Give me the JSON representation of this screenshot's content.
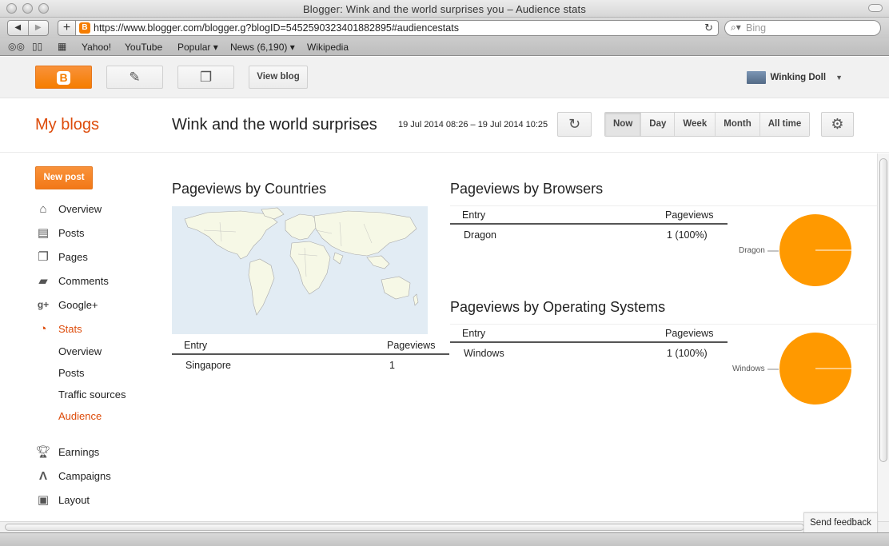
{
  "window": {
    "title": "Blogger: Wink and the world surprises you – Audience stats"
  },
  "browser": {
    "url": "https://www.blogger.com/blogger.g?blogID=5452590323401882895#audiencestats",
    "search_placeholder": "Bing",
    "bookmarks": [
      "Yahoo!",
      "YouTube",
      "Popular ▾",
      "News (6,190) ▾",
      "Wikipedia"
    ]
  },
  "topbar": {
    "view_blog": "View blog",
    "user_name": "Winking Doll"
  },
  "header": {
    "my_blogs": "My blogs",
    "blog_title": "Wink and the world surprises",
    "date_range": "19 Jul 2014 08:26 – 19 Jul 2014 10:25",
    "ranges": [
      "Now",
      "Day",
      "Week",
      "Month",
      "All time"
    ],
    "active_range": "Now"
  },
  "sidebar": {
    "new_post": "New post",
    "items": [
      {
        "label": "Overview",
        "icon": "home-icon"
      },
      {
        "label": "Posts",
        "icon": "posts-icon"
      },
      {
        "label": "Pages",
        "icon": "pages-icon"
      },
      {
        "label": "Comments",
        "icon": "comment-icon"
      },
      {
        "label": "Google+",
        "icon": "google-plus-icon"
      },
      {
        "label": "Stats",
        "icon": "pie-chart-icon"
      }
    ],
    "stats_sub": [
      "Overview",
      "Posts",
      "Traffic sources",
      "Audience"
    ],
    "items2": [
      {
        "label": "Earnings",
        "icon": "trophy-icon"
      },
      {
        "label": "Campaigns",
        "icon": "campaigns-icon"
      },
      {
        "label": "Layout",
        "icon": "layout-icon"
      }
    ],
    "active_sub": "Audience"
  },
  "main": {
    "countries": {
      "title": "Pageviews by Countries",
      "headers": {
        "entry": "Entry",
        "pageviews": "Pageviews"
      },
      "rows": [
        {
          "entry": "Singapore",
          "pageviews": "1"
        }
      ]
    },
    "browsers": {
      "title": "Pageviews by Browsers",
      "headers": {
        "entry": "Entry",
        "pageviews": "Pageviews"
      },
      "rows": [
        {
          "entry": "Dragon",
          "pageviews": "1 (100%)"
        }
      ],
      "pie_label": "Dragon"
    },
    "os": {
      "title": "Pageviews by Operating Systems",
      "headers": {
        "entry": "Entry",
        "pageviews": "Pageviews"
      },
      "rows": [
        {
          "entry": "Windows",
          "pageviews": "1 (100%)"
        }
      ],
      "pie_label": "Windows"
    }
  },
  "feedback": "Send feedback",
  "colors": {
    "accent": "#f57d00",
    "link_active": "#dd4b0a",
    "pie": "#ff9900"
  }
}
